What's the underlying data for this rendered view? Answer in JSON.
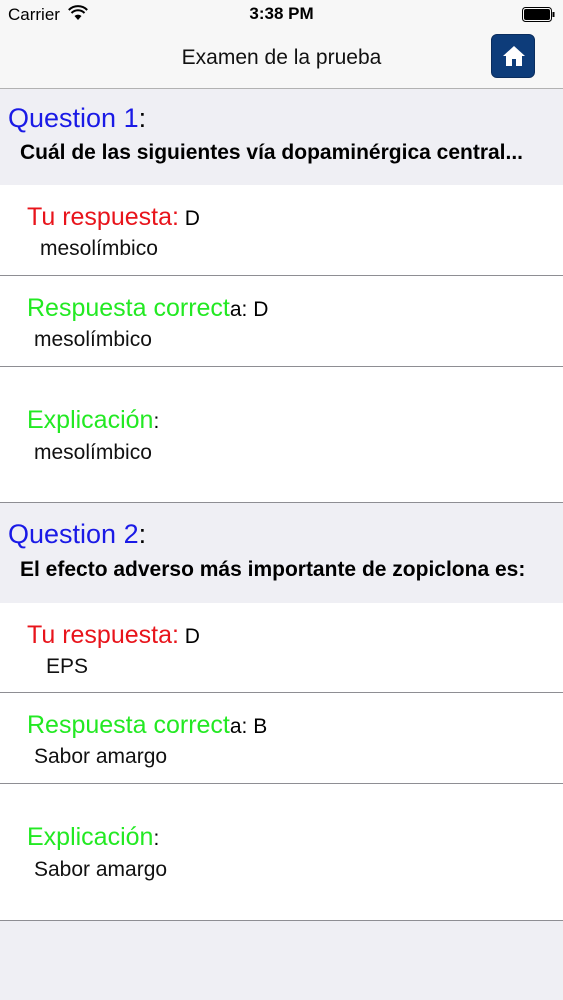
{
  "status": {
    "carrier": "Carrier",
    "time": "3:38 PM"
  },
  "nav": {
    "title": "Examen de la prueba"
  },
  "questions": [
    {
      "label": "Question 1",
      "colon": ":",
      "text": "Cuál de las siguientes vía dopaminérgica central...",
      "your_answer_label": "Tu respuesta:",
      "your_answer_letter": " D",
      "your_answer_text": "mesolímbico",
      "correct_label": "Respuesta correct",
      "correct_suffix": "a: D",
      "correct_text": "mesolímbico",
      "explanation_label": "Explicación",
      "explanation_suffix": ":",
      "explanation_text": "mesolímbico"
    },
    {
      "label": "Question 2",
      "colon": ":",
      "text": "El efecto adverso más importante de zopiclona es:",
      "your_answer_label": "Tu respuesta:",
      "your_answer_letter": " D",
      "your_answer_text": "EPS",
      "correct_label": "Respuesta correct",
      "correct_suffix": "a: B",
      "correct_text": "Sabor amargo",
      "explanation_label": "Explicación",
      "explanation_suffix": ":",
      "explanation_text": "Sabor amargo"
    }
  ]
}
